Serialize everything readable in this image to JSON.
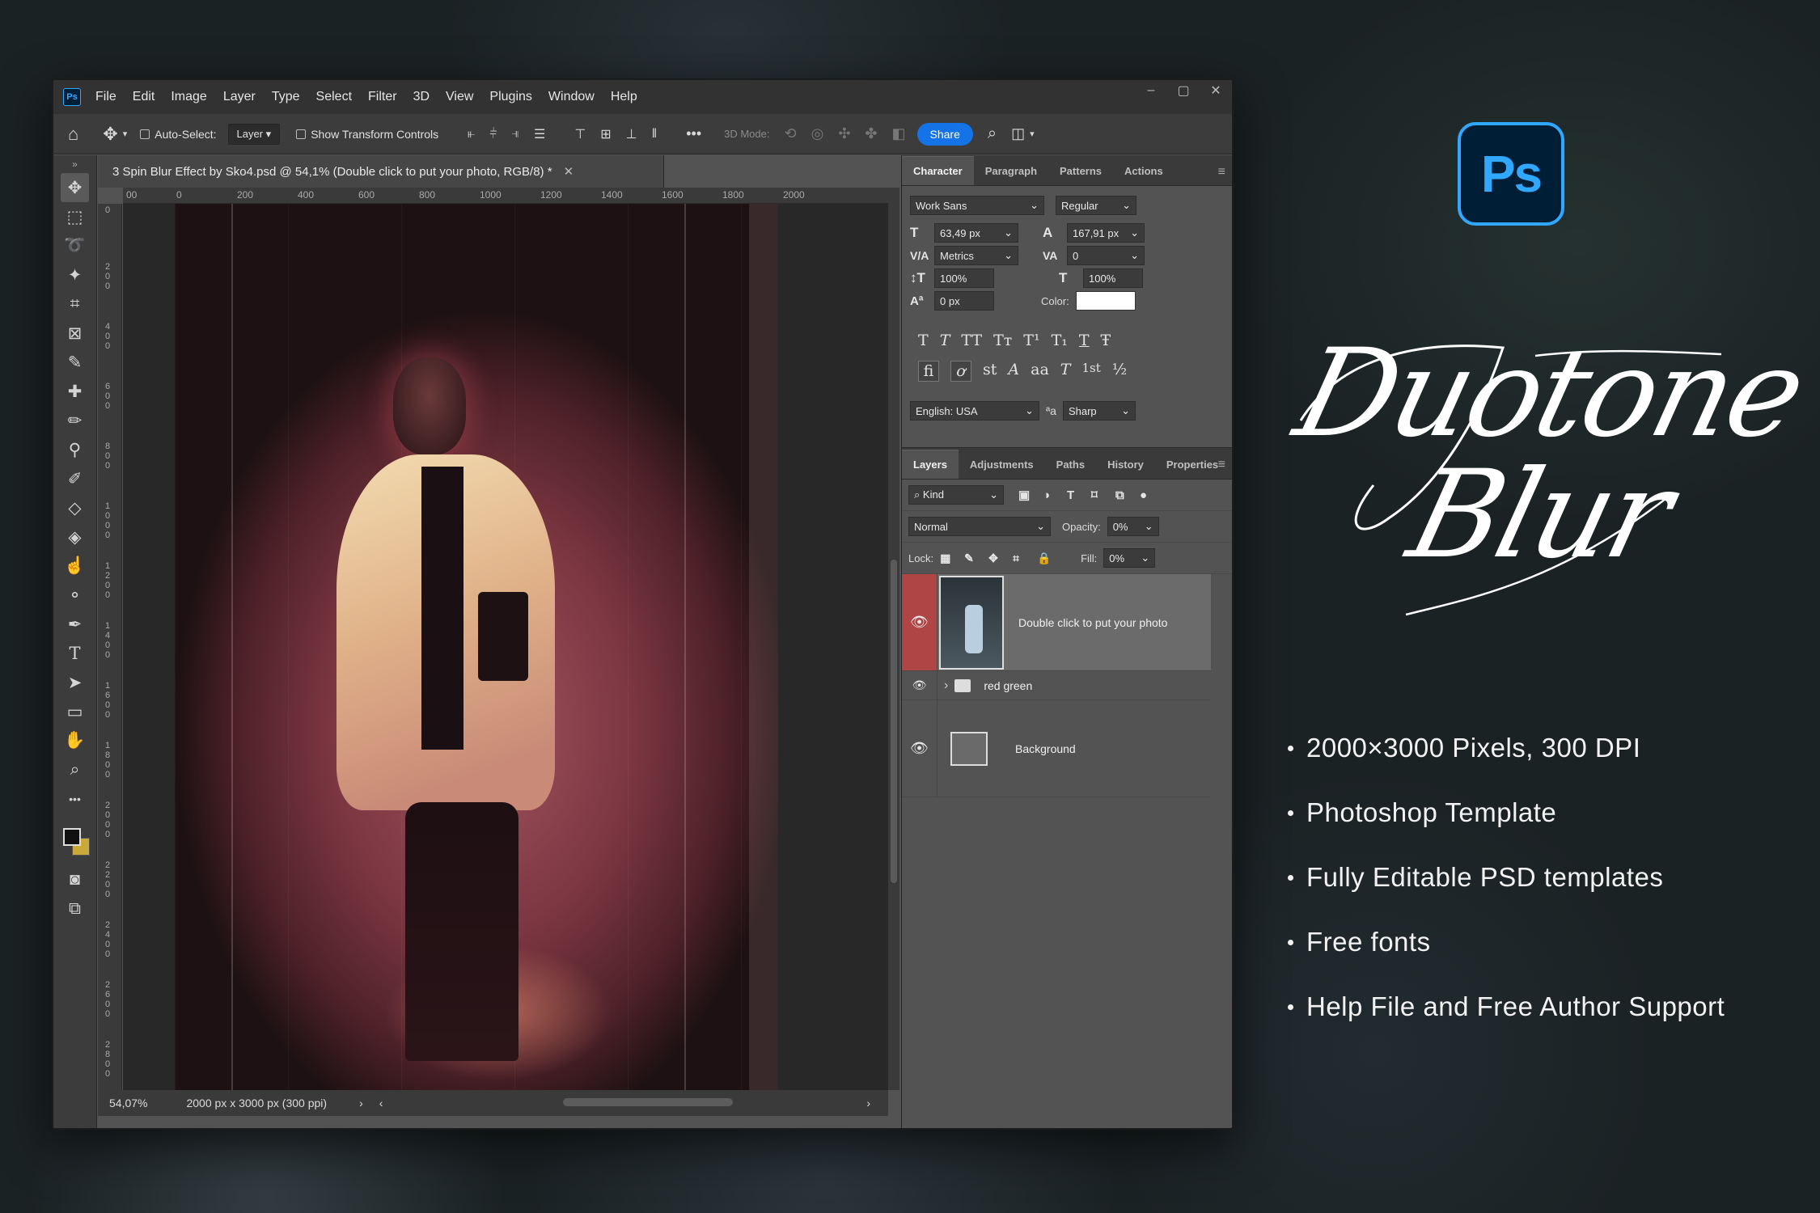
{
  "app": {
    "logo_text": "Ps",
    "menu": [
      "File",
      "Edit",
      "Image",
      "Layer",
      "Type",
      "Select",
      "Filter",
      "3D",
      "View",
      "Plugins",
      "Window",
      "Help"
    ],
    "window_controls": [
      "–",
      "▢",
      "✕"
    ]
  },
  "options_bar": {
    "auto_select_label": "Auto-Select:",
    "auto_select_value": "Layer",
    "transform_label": "Show Transform Controls",
    "mode_label": "3D Mode:",
    "share_label": "Share"
  },
  "document": {
    "tab_title": "3 Spin Blur Effect by Sko4.psd @ 54,1% (Double click to put your photo, RGB/8) *",
    "ruler_top": [
      "00",
      "0",
      "200",
      "400",
      "600",
      "800",
      "1000",
      "1200",
      "1400",
      "1600",
      "1800",
      "2000"
    ],
    "ruler_left": [
      "0",
      "2\n0\n0",
      "4\n0\n0",
      "6\n0\n0",
      "8\n0\n0",
      "1\n0\n0\n0",
      "1\n2\n0\n0",
      "1\n4\n0\n0",
      "1\n6\n0\n0",
      "1\n8\n0\n0",
      "2\n0\n0\n0",
      "2\n2\n0\n0",
      "2\n4\n0\n0",
      "2\n6\n0\n0",
      "2\n8\n0\n0"
    ],
    "zoom": "54,07%",
    "size_info": "2000 px x 3000 px (300 ppi)"
  },
  "character_panel": {
    "tabs": [
      "Character",
      "Paragraph",
      "Patterns",
      "Actions"
    ],
    "font_family": "Work Sans",
    "font_style": "Regular",
    "font_size": "63,49 px",
    "leading": "167,91 px",
    "kerning": "Metrics",
    "tracking": "0",
    "vertical_scale": "100%",
    "horizontal_scale": "100%",
    "baseline_shift": "0 px",
    "color_label": "Color:",
    "language": "English: USA",
    "antialias_icon": "ªa",
    "antialias": "Sharp",
    "type_styles": [
      "T",
      "T",
      "TT",
      "Tт",
      "T¹",
      "T₁",
      "T",
      "Ŧ"
    ],
    "opentype": [
      "fi",
      "ơ",
      "st",
      "A",
      "aa",
      "T",
      "1st",
      "½"
    ]
  },
  "layers_panel": {
    "tabs": [
      "Layers",
      "Adjustments",
      "Paths",
      "History",
      "Properties"
    ],
    "filter_kind": "Kind",
    "blend_mode": "Normal",
    "opacity_label": "Opacity:",
    "opacity_value": "0%",
    "lock_label": "Lock:",
    "fill_label": "Fill:",
    "fill_value": "0%",
    "layers": [
      {
        "name": "Double click to put your photo"
      },
      {
        "name": "red green"
      },
      {
        "name": "Background"
      }
    ],
    "footer_icons": [
      "link-icon",
      "fx-icon",
      "mask-icon",
      "adjustment-icon",
      "folder-icon",
      "new-layer-icon",
      "trash-icon"
    ]
  },
  "promo": {
    "logo_text": "Ps",
    "script_line1": "Duotone",
    "script_line2": "Blur",
    "features": [
      "2000×3000 Pixels, 300 DPI",
      "Photoshop Template",
      "Fully Editable PSD templates",
      "Free fonts",
      "Help File and Free Author Support"
    ]
  },
  "colors": {
    "accent_blue": "#31a8ff",
    "share_blue": "#1473e6",
    "layer_highlight": "#b04545",
    "background_color_swatch": "#c9a93a"
  }
}
